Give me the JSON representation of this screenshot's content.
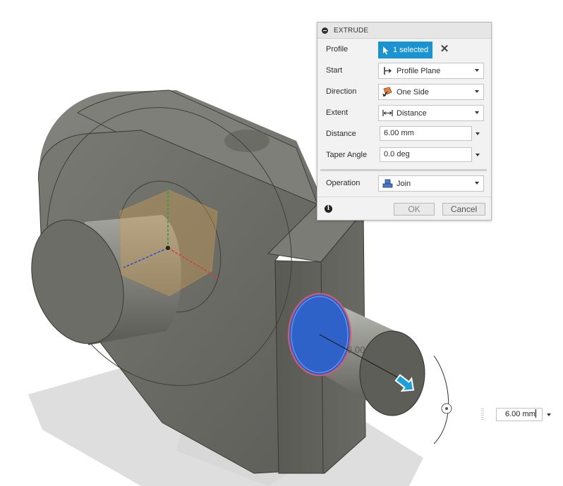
{
  "dialog": {
    "title": "EXTRUDE",
    "profile": {
      "label": "Profile",
      "value": "1 selected"
    },
    "start": {
      "label": "Start",
      "value": "Profile Plane"
    },
    "direction": {
      "label": "Direction",
      "value": "One Side"
    },
    "extent": {
      "label": "Extent",
      "value": "Distance"
    },
    "distance": {
      "label": "Distance",
      "value": "6.00 mm"
    },
    "taper": {
      "label": "Taper Angle",
      "value": "0.0 deg"
    },
    "operation": {
      "label": "Operation",
      "value": "Join"
    },
    "ok_label": "OK",
    "cancel_label": "Cancel"
  },
  "canvas": {
    "dimension_label": "6.00",
    "distance_input": "6.00 mm"
  },
  "colors": {
    "selected_face": "#2f62c9",
    "accent": "#1a93d3",
    "body": "#6e6e68"
  }
}
